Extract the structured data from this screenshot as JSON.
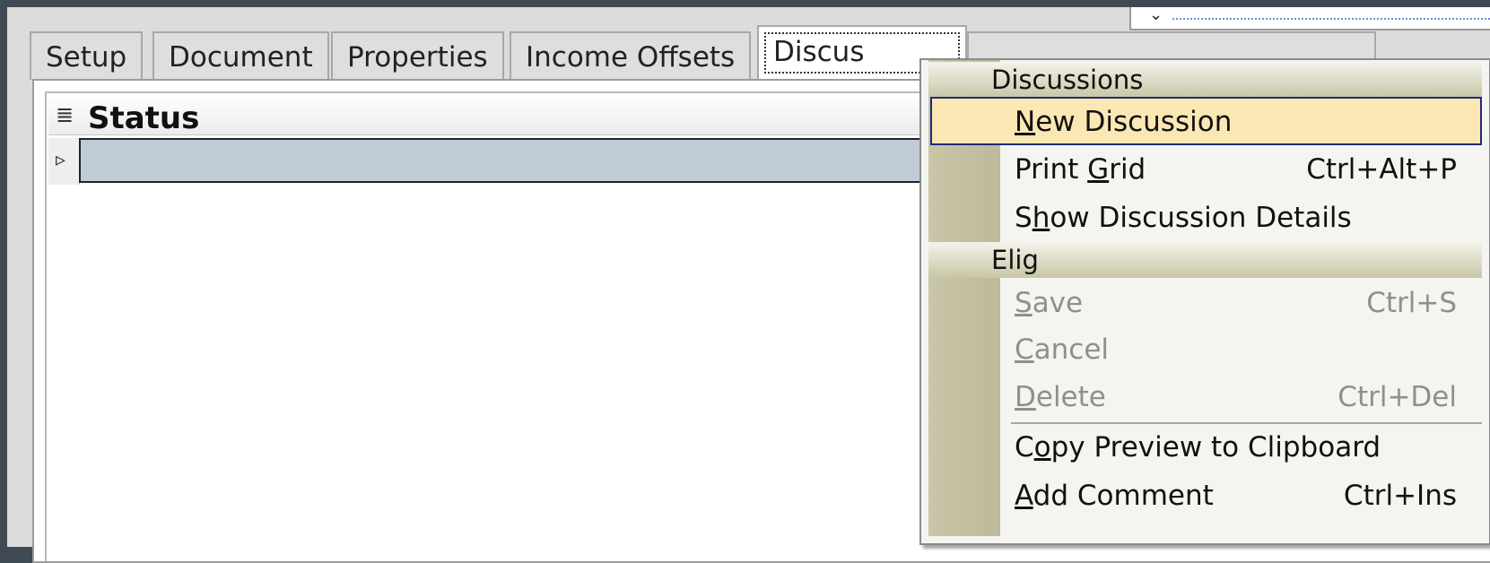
{
  "tabs": [
    {
      "label": "Setup"
    },
    {
      "label": "Document"
    },
    {
      "label": "Properties"
    },
    {
      "label": "Income Offsets"
    },
    {
      "label": "Discus"
    }
  ],
  "grid": {
    "header_title": "Status"
  },
  "context_menu": {
    "sections": [
      {
        "title": "Discussions"
      },
      {
        "title": "Elig"
      }
    ],
    "items": [
      {
        "label_pre": "",
        "label_u": "N",
        "label_post": "ew Discussion",
        "shortcut": "",
        "state": "highlighted"
      },
      {
        "label_pre": "Print ",
        "label_u": "G",
        "label_post": "rid",
        "shortcut": "Ctrl+Alt+P",
        "state": "enabled"
      },
      {
        "label_pre": "S",
        "label_u": "h",
        "label_post": "ow Discussion Details",
        "shortcut": "",
        "state": "enabled"
      },
      {
        "label_pre": "",
        "label_u": "S",
        "label_post": "ave",
        "shortcut": "Ctrl+S",
        "state": "disabled"
      },
      {
        "label_pre": "",
        "label_u": "C",
        "label_post": "ancel",
        "shortcut": "",
        "state": "disabled"
      },
      {
        "label_pre": "",
        "label_u": "D",
        "label_post": "elete",
        "shortcut": "Ctrl+Del",
        "state": "disabled"
      },
      {
        "label_pre": "C",
        "label_u": "o",
        "label_post": "py Preview to Clipboard",
        "shortcut": "",
        "state": "enabled"
      },
      {
        "label_pre": "",
        "label_u": "A",
        "label_post": "dd Comment",
        "shortcut": "Ctrl+Ins",
        "state": "enabled"
      }
    ]
  },
  "colors": {
    "highlight_bg": "#fbe7b3",
    "highlight_border": "#1f2a7a",
    "selected_row": "#bfcbd7"
  }
}
